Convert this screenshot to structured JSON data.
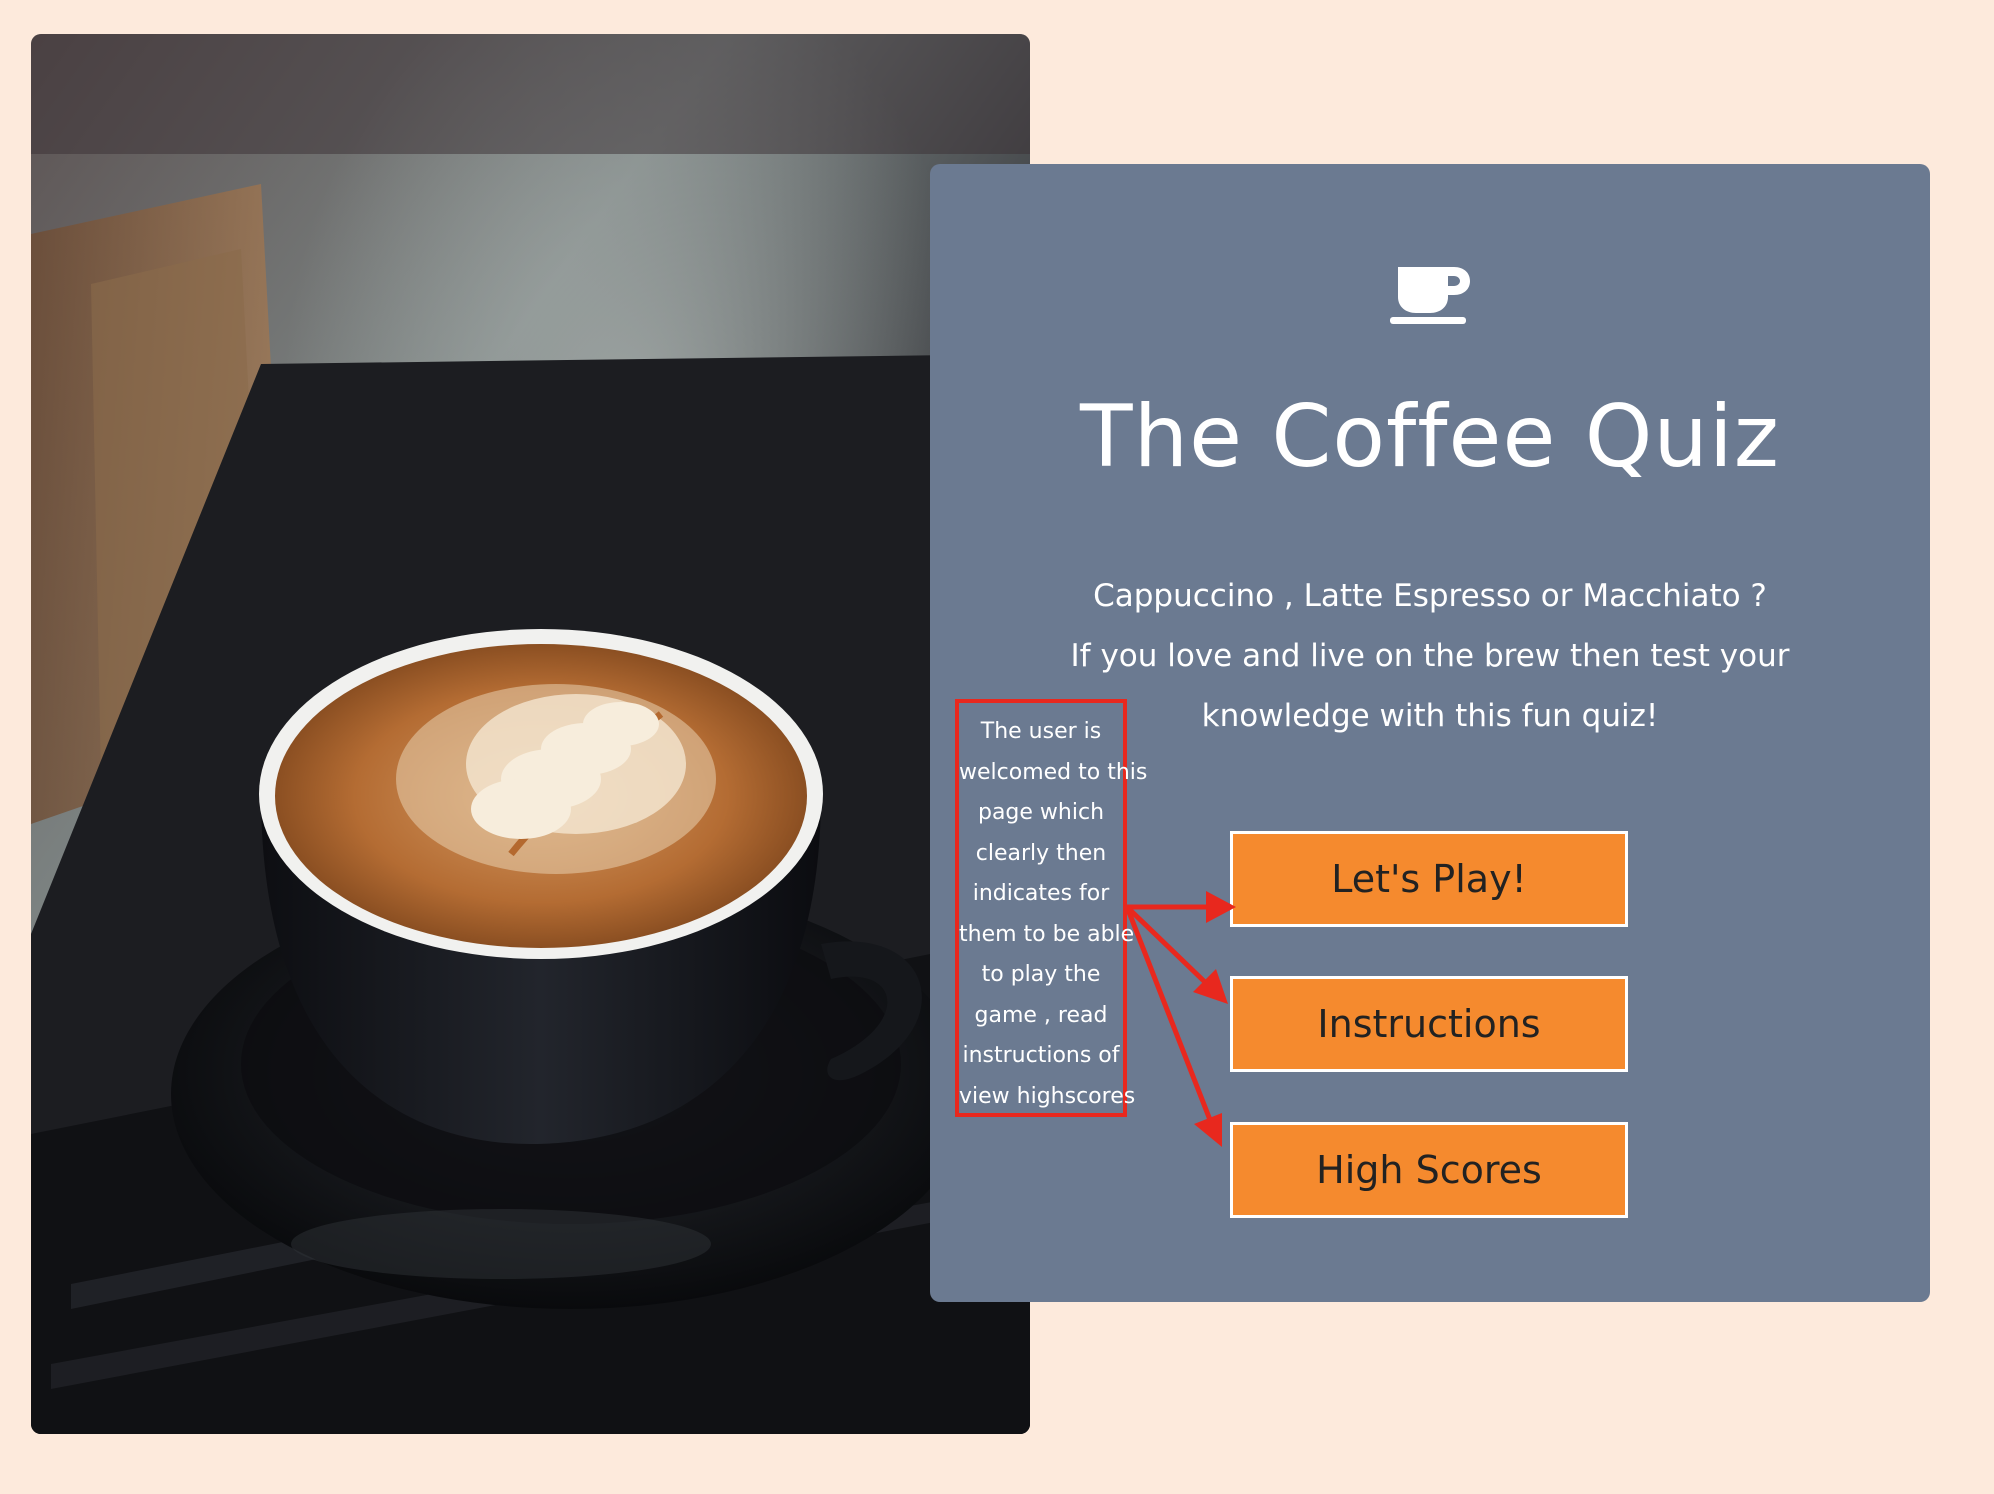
{
  "quiz": {
    "icon": "coffee-cup-icon",
    "title": "The Coffee Quiz",
    "tagline_lines": [
      "Cappuccino , Latte Espresso or Macchiato ?",
      "If you love and live on the brew then test your",
      "knowledge with this fun quiz!"
    ],
    "buttons": {
      "play": "Let's Play!",
      "instructions": "Instructions",
      "high_scores": "High Scores"
    }
  },
  "annotation": {
    "lines": [
      "The user is",
      "welcomed to this",
      "page which",
      "clearly then",
      "indicates for",
      "them to be able",
      "to play the",
      "game , read",
      "instructions  of",
      "view highscores"
    ]
  },
  "photo": {
    "subject": "latte art coffee cup on saucer"
  },
  "colors": {
    "page_background": "#fdeadc",
    "panel": "#6b7a91",
    "button": "#f58a2e",
    "annotation": "#e8281e"
  }
}
